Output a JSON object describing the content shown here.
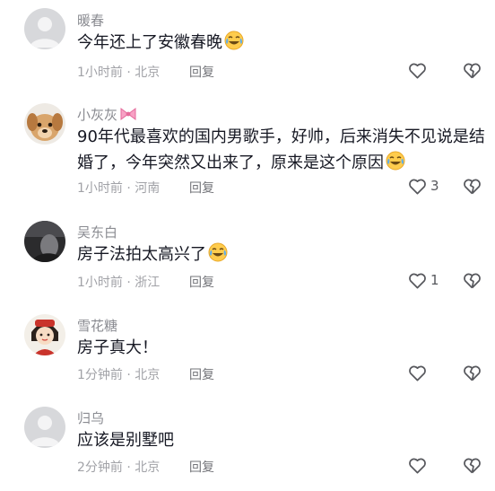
{
  "comments": [
    {
      "username": "暖春",
      "text": "今年还上了安徽春晚",
      "emoji": "tears-of-joy-emoji",
      "time": "1小时前",
      "location": "北京",
      "reply": "回复",
      "likes": ""
    },
    {
      "username": "小灰灰",
      "username_emoji": "pink-bow-icon",
      "text": "90年代最喜欢的国内男歌手，好帅，后来消失不见说是结婚了，今年突然又出来了，原来是这个原因",
      "emoji": "tears-of-joy-emoji",
      "time": "1小时前",
      "location": "河南",
      "reply": "回复",
      "likes": "3"
    },
    {
      "username": "吴东白",
      "text": "房子法拍太高兴了",
      "emoji": "tears-of-joy-emoji",
      "time": "1小时前",
      "location": "浙江",
      "reply": "回复",
      "likes": "1"
    },
    {
      "username": "雪花糖",
      "text": "房子真大！",
      "time": "1分钟前",
      "location": "北京",
      "reply": "回复",
      "likes": ""
    },
    {
      "username": "归乌",
      "text": "应该是别墅吧",
      "time": "2分钟前",
      "location": "北京",
      "reply": "回复",
      "likes": ""
    }
  ],
  "meta_separator": "·",
  "colors": {
    "username": "#8a8b91",
    "text": "#161823",
    "meta": "#a1a2a7",
    "icon": "#57585d"
  }
}
